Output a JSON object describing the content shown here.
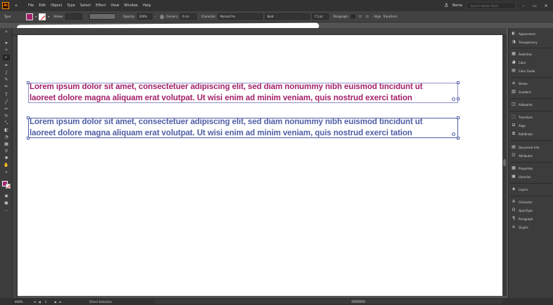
{
  "app": {
    "logo": "Ai"
  },
  "menu": [
    "File",
    "Edit",
    "Object",
    "Type",
    "Select",
    "Effect",
    "View",
    "Window",
    "Help"
  ],
  "workspace": {
    "label": "Reme",
    "search_placeholder": "Search Adobe Stock"
  },
  "control_bar": {
    "object_label": "Type",
    "stroke_label": "Stroke:",
    "opacity_label": "Opacity:",
    "opacity_value": "100%",
    "corners_label": "Corners:",
    "corners_value": "0 cm",
    "character_label": "Character:",
    "font_family": "Myriad Pro",
    "font_style": "Bold",
    "font_size": "7.5 pt",
    "paragraph_label": "Paragraph:",
    "align_label": "Align",
    "transform_label": "Transform"
  },
  "canvas_text": {
    "block1_line1": "Lorem ipsum dolor sit amet, consectetuer adipiscing elit, sed diam nonummy nibh euismod tincidunt ut",
    "block1_line2": "laoreet dolore magna aliquam erat volutpat. Ut wisi enim ad minim veniam, quis nostrud exerci tation",
    "block2_line1": "Lorem ipsum dolor sit amet, consectetuer adipiscing elit, sed diam nonummy nibh euismod tincidunt ut",
    "block2_line2": "laoreet dolore magna aliquam erat volutpat. Ut wisi enim ad minim veniam, quis nostrud exerci tation"
  },
  "colors": {
    "fill": "#a4236c",
    "selection": "#4f5fa6"
  },
  "panels": [
    {
      "icon": "appearance-icon",
      "label": "Appearance"
    },
    {
      "icon": "transparency-icon",
      "label": "Transparency"
    },
    {
      "icon": "swatches-icon",
      "label": "Swatches"
    },
    {
      "icon": "color-icon",
      "label": "Color"
    },
    {
      "icon": "color-guide-icon",
      "label": "Color Guide"
    },
    {
      "icon": "stroke-icon",
      "label": "Stroke"
    },
    {
      "icon": "gradient-icon",
      "label": "Gradient"
    },
    {
      "icon": "artboards-icon",
      "label": "Artboards"
    },
    {
      "icon": "transform-icon",
      "label": "Transform"
    },
    {
      "icon": "align-icon",
      "label": "Align"
    },
    {
      "icon": "pathfinder-icon",
      "label": "Pathfinder"
    },
    {
      "icon": "document-info-icon",
      "label": "Document Info"
    },
    {
      "icon": "attributes-icon",
      "label": "Attributes"
    },
    {
      "icon": "properties-icon",
      "label": "Properties"
    },
    {
      "icon": "libraries-icon",
      "label": "Libraries"
    },
    {
      "icon": "layers-icon",
      "label": "Layers"
    },
    {
      "icon": "character-icon",
      "label": "Character"
    },
    {
      "icon": "opentype-icon",
      "label": "OpenType"
    },
    {
      "icon": "paragraph-icon",
      "label": "Paragraph"
    },
    {
      "icon": "glyphs-icon",
      "label": "Glyphs"
    }
  ],
  "status_bar": {
    "zoom": "400%",
    "artboard": "1",
    "tool": "Direct Selection"
  }
}
